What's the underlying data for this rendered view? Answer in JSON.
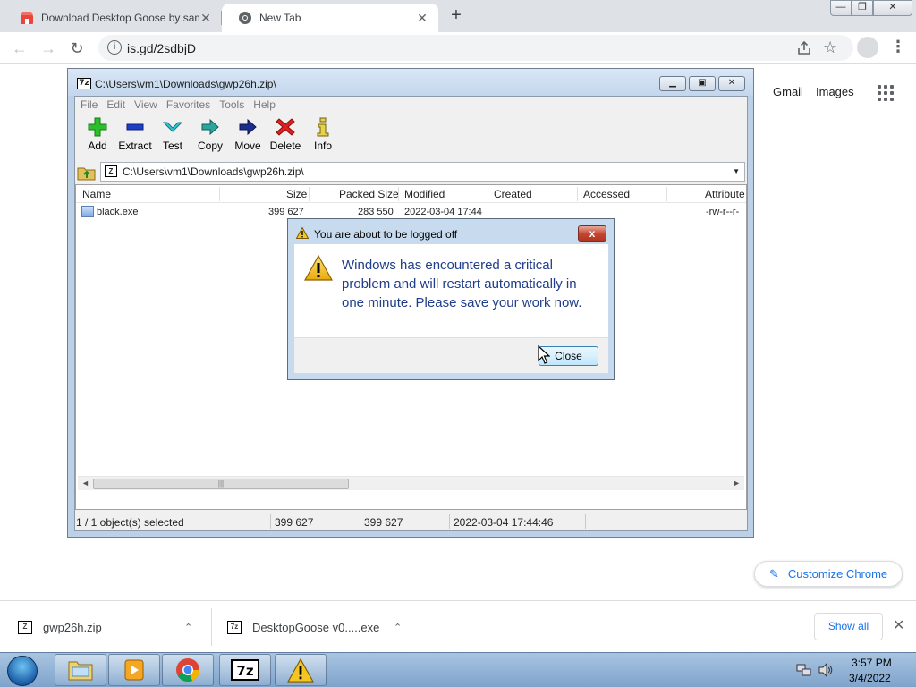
{
  "browser": {
    "tabs": [
      {
        "title": "Download Desktop Goose by sam",
        "active": false
      },
      {
        "title": "New Tab",
        "active": true
      }
    ],
    "url": "is.gd/2sdbjD",
    "ntp": {
      "gmail": "Gmail",
      "images": "Images",
      "customize": "Customize Chrome"
    }
  },
  "zip": {
    "title": "C:\\Users\\vm1\\Downloads\\gwp26h.zip\\",
    "menu": [
      "File",
      "Edit",
      "View",
      "Favorites",
      "Tools",
      "Help"
    ],
    "tools": [
      "Add",
      "Extract",
      "Test",
      "Copy",
      "Move",
      "Delete",
      "Info"
    ],
    "address": "C:\\Users\\vm1\\Downloads\\gwp26h.zip\\",
    "columns": [
      "Name",
      "Size",
      "Packed Size",
      "Modified",
      "Created",
      "Accessed",
      "Attribute"
    ],
    "rows": [
      {
        "name": "black.exe",
        "size": "399 627",
        "packed": "283 550",
        "modified": "2022-03-04 17:44",
        "attr": "-rw-r--r-"
      }
    ],
    "status": {
      "selected": "1 / 1 object(s) selected",
      "size": "399 627",
      "packed": "399 627",
      "modified": "2022-03-04 17:44:46"
    }
  },
  "dialog": {
    "title": "You are about to be logged off",
    "message": "Windows has encountered a critical problem and will restart automatically in one minute. Please save your work now.",
    "close_label": "Close",
    "title_close": "x"
  },
  "downloads": {
    "items": [
      "gwp26h.zip",
      "DesktopGoose v0.....exe"
    ],
    "show_all": "Show all"
  },
  "taskbar": {
    "time": "3:57 PM",
    "date": "3/4/2022"
  },
  "colors": {
    "accent": "#1a73e8",
    "dialog_text": "#1f3d8a",
    "close_red": "#c4442f"
  }
}
